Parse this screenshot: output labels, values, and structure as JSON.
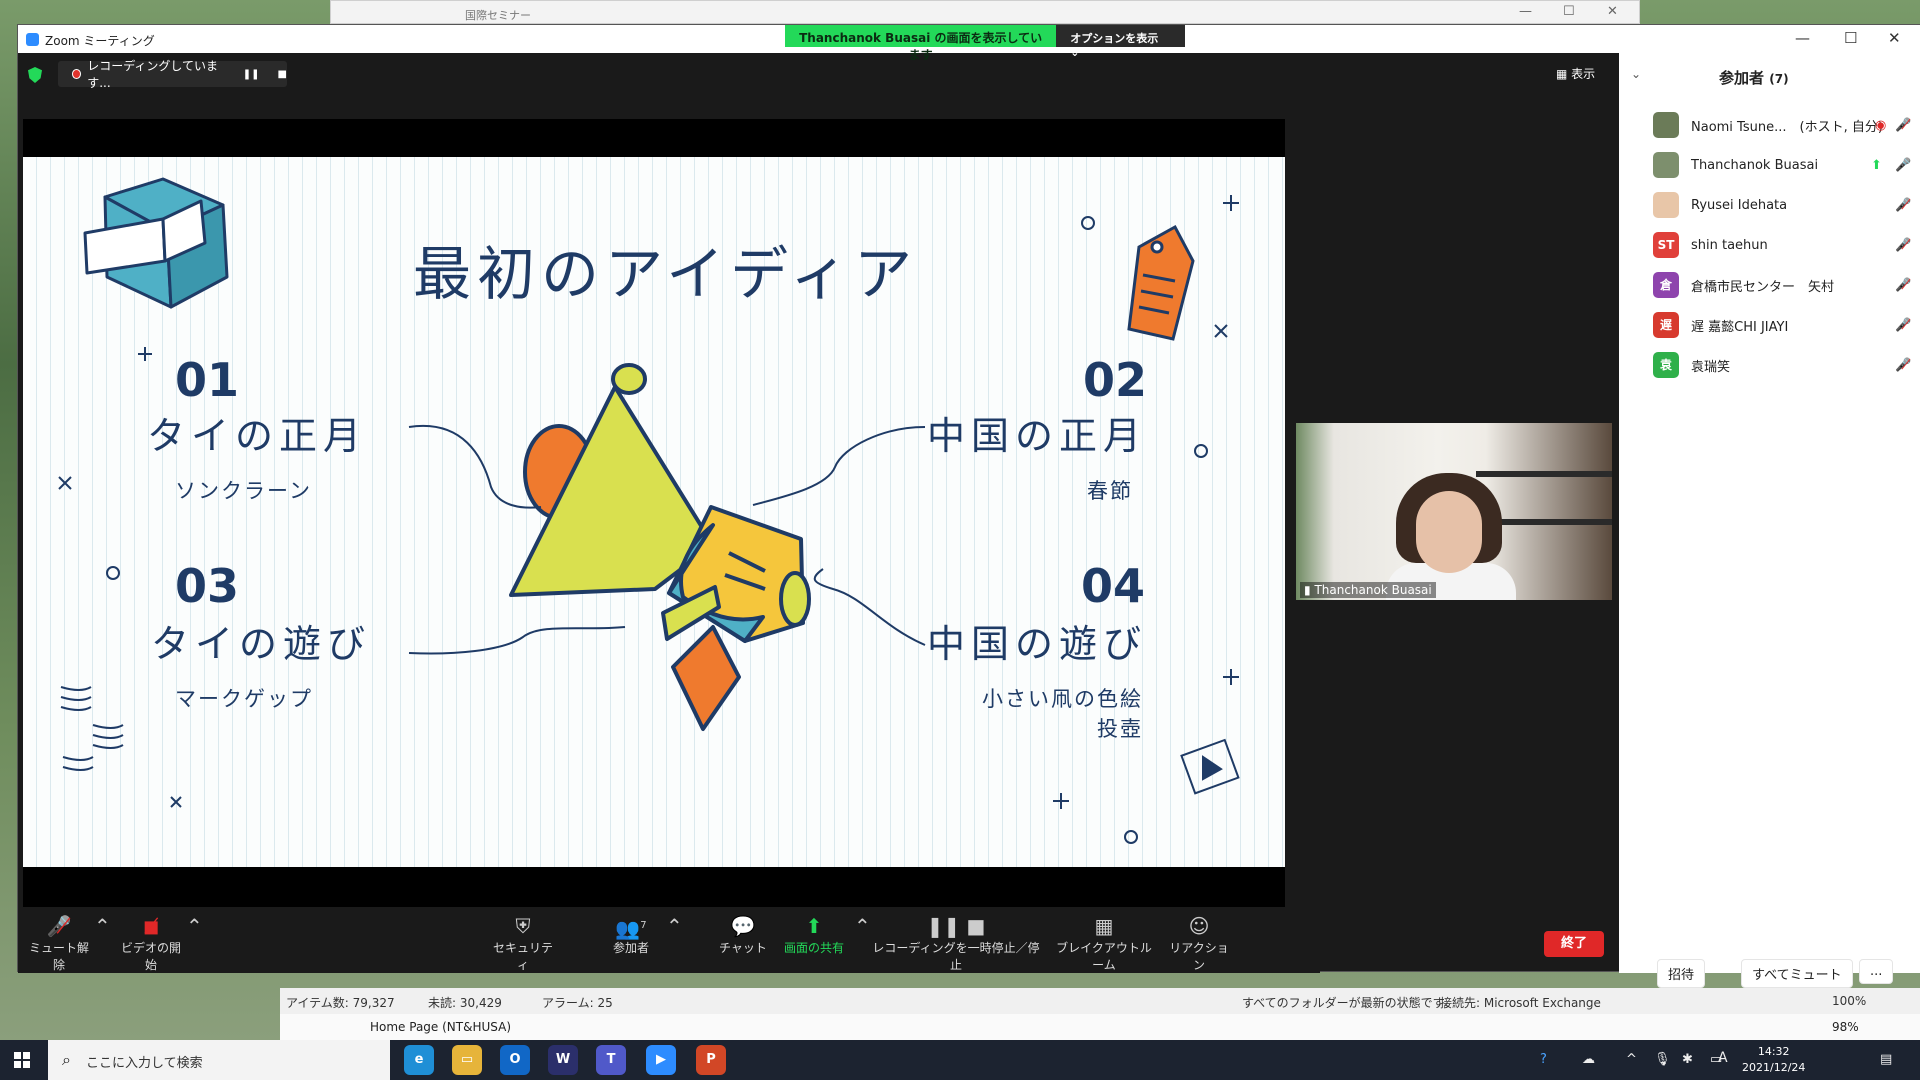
{
  "outlook_window": {
    "title": "国際セミナー"
  },
  "zoom": {
    "app_title": "Zoom ミーティング",
    "share_banner": "Thanchanok  Buasai の画面を表示しています",
    "share_options": "オプションを表示",
    "recording_status": "レコーディングしています...",
    "view_button": "表示",
    "toolbar": {
      "mute": "ミュート解除",
      "video": "ビデオの開始",
      "security": "セキュリティ",
      "participants": "参加者",
      "participants_count": "7",
      "chat": "チャット",
      "share": "画面の共有",
      "recording": "レコーディングを一時停止／停止",
      "breakout": "ブレイクアウトルーム",
      "reactions": "リアクション",
      "end": "終了"
    },
    "video_tile": {
      "name": "Thanchanok Buasai"
    },
    "accent_color": "#23d959",
    "end_color": "#e02828"
  },
  "slide": {
    "title": "最初のアイディア",
    "items": [
      {
        "num": "01",
        "heading": "タイの正月",
        "sub": "ソンクラーン"
      },
      {
        "num": "02",
        "heading": "中国の正月",
        "sub": "春節"
      },
      {
        "num": "03",
        "heading": "タイの遊び",
        "sub": "マークゲップ"
      },
      {
        "num": "04",
        "heading": "中国の遊び",
        "sub1": "小さい凧の色絵",
        "sub2": "投壺"
      }
    ],
    "colors": {
      "ink": "#1f3b66",
      "yellow": "#d9e04f",
      "blue": "#4fb0c6",
      "orange": "#ef7a2e"
    }
  },
  "participants_panel": {
    "title": "参加者",
    "count": "(7)",
    "list": [
      {
        "name": "Naomi Tsune...",
        "role": "(ホスト, 自分)",
        "avatar": "",
        "color": "#6b7b58"
      },
      {
        "name": "Thanchanok Buasai",
        "avatar": "",
        "color": "#7d8f6d"
      },
      {
        "name": "Ryusei Idehata",
        "avatar": "",
        "color": "#e8c6a8"
      },
      {
        "name": "shin taehun",
        "avatar": "ST",
        "color": "#e0403a"
      },
      {
        "name": "倉橋市民センター　矢村",
        "avatar": "倉",
        "color": "#8e44ad"
      },
      {
        "name": "遅 嘉懿CHI JIAYI",
        "avatar": "遅",
        "color": "#d73a2e"
      },
      {
        "name": "袁瑞笑",
        "avatar": "袁",
        "color": "#2fb04a"
      }
    ],
    "invite": "招待",
    "mute_all": "すべてミュート",
    "more": "..."
  },
  "outlook_status": {
    "items": "アイテム数: 79,327",
    "unread": "未読: 30,429",
    "alarm": "アラーム: 25",
    "folders": "すべてのフォルダーが最新の状態です。",
    "connection": "接続先: Microsoft Exchange",
    "zoom_top": "100%",
    "folder_name": "Home Page (NT&HUSA)",
    "zoom_bottom": "98%"
  },
  "taskbar": {
    "search_placeholder": "ここに入力して検索",
    "time": "14:32",
    "date": "2021/12/24",
    "ime": "A"
  }
}
